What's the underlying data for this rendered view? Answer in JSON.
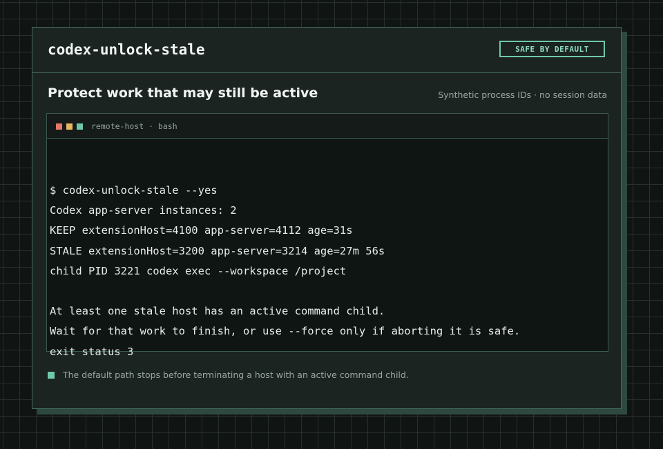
{
  "header": {
    "title": "codex-unlock-stale",
    "badge": "SAFE BY DEFAULT"
  },
  "section": {
    "title": "Protect work that may still be active",
    "note": "Synthetic process IDs · no session data"
  },
  "terminal": {
    "bar_label": "remote-host · bash",
    "colors": {
      "dot_red": "#e3796b",
      "dot_yellow": "#e6b85f",
      "dot_green": "#6fc8ad"
    },
    "lines": [
      "$ codex-unlock-stale --yes",
      "Codex app-server instances: 2",
      "KEEP extensionHost=4100 app-server=4112 age=31s",
      "STALE extensionHost=3200 app-server=3214 age=27m 56s",
      "child PID 3221 codex exec --workspace /project",
      "",
      "At least one stale host has an active command child.",
      "Wait for that work to finish, or use --force only if aborting it is safe.",
      "exit status 3"
    ]
  },
  "footnote": {
    "text": "The default path stops before terminating a host with an active command child."
  },
  "colors": {
    "accent": "#6fc8ad",
    "border": "#456b5d",
    "background": "#101513"
  }
}
